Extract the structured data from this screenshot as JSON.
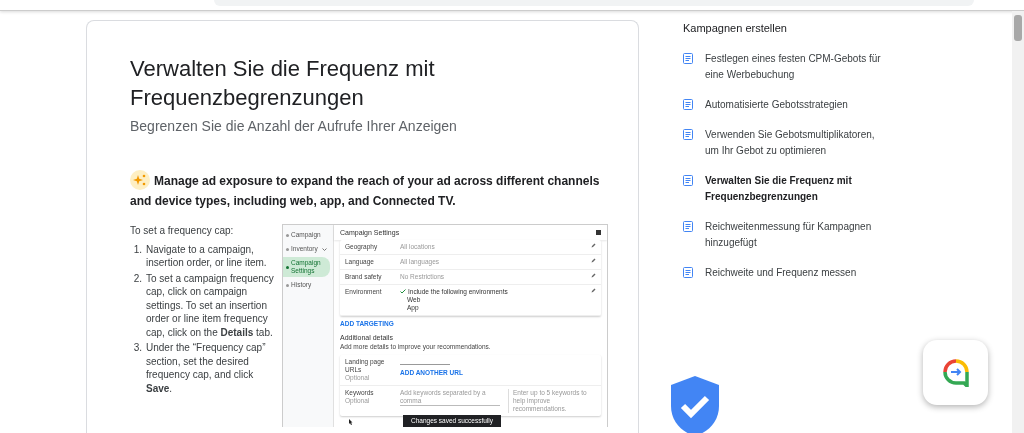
{
  "article": {
    "title": "Verwalten Sie die Frequenz mit Frequenzbegrenzungen",
    "subtitle": "Begrenzen Sie die Anzahl der Aufrufe Ihrer Anzeigen",
    "callout": "Manage ad exposure to expand the reach of your ad across different channels and device types, including web, app, and Connected TV.",
    "intro": "To set a frequency cap:",
    "steps": [
      {
        "number": "1.",
        "text": "Navigate to a campaign, insertion order, or line item."
      },
      {
        "number": "2.",
        "text": "To set a campaign frequency cap, click on campaign settings. To set an insertion order or line item frequency cap, click on the **Details** tab."
      },
      {
        "number": "3.",
        "text": "Under the “Frequency cap” section, set the desired frequency cap, and click **Save**."
      }
    ],
    "screenshot": {
      "nav": [
        {
          "label": "Campaign",
          "kind": "link",
          "selected": false
        },
        {
          "label": "Inventory",
          "kind": "group",
          "selected": false
        },
        {
          "label": "Campaign Settings",
          "kind": "link",
          "selected": true
        },
        {
          "label": "History",
          "kind": "link",
          "selected": false
        }
      ],
      "header_title": "Campaign Settings",
      "settings": [
        {
          "label": "Geography",
          "kind": "plain",
          "value": "All locations"
        },
        {
          "label": "Language",
          "kind": "plain",
          "value": "All languages"
        },
        {
          "label": "Brand safety",
          "kind": "plain",
          "value": "No Restrictions"
        },
        {
          "label": "Environment",
          "kind": "checklist",
          "value": "Include the following environments",
          "options": [
            "Web",
            "App"
          ]
        }
      ],
      "add_targeting": "ADD TARGETING",
      "details_title": "Additional details",
      "details_subtitle": "Add more details to improve your recommendations.",
      "fields": [
        {
          "kind": "url",
          "label": "Landing page URLs",
          "hint": "Optional",
          "link": "ADD ANOTHER URL"
        },
        {
          "kind": "keywords",
          "label": "Keywords",
          "hint": "Optional",
          "placeholder": "Add keywords separated by a comma",
          "help": "Enter up to 5 keywords to help improve recommendations."
        }
      ],
      "toast": "Changes saved successfully"
    }
  },
  "sidebar": {
    "heading": "Kampagnen erstellen",
    "items": [
      {
        "label": "Festlegen eines festen CPM-Gebots für eine Werbebuchung",
        "selected": false
      },
      {
        "label": "Automatisierte Gebotsstrategien",
        "selected": false
      },
      {
        "label": "Verwenden Sie Gebotsmultiplikatoren, um Ihr Gebot zu optimieren",
        "selected": false
      },
      {
        "label": "Verwalten Sie die Frequenz mit Frequenzbegrenzungen",
        "selected": true
      },
      {
        "label": "Reichweitenmessung für Kampagnen hinzugefügt",
        "selected": false
      },
      {
        "label": "Reichweite und Frequenz messen",
        "selected": false
      }
    ]
  }
}
